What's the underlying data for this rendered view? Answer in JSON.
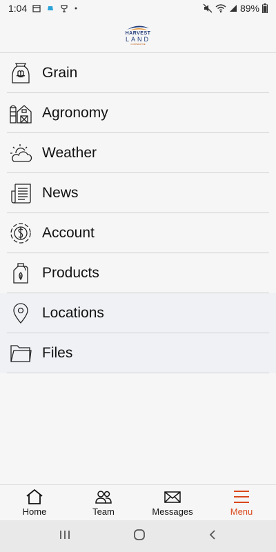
{
  "status_bar": {
    "time": "1:04",
    "battery": "89%"
  },
  "header": {
    "logo_line1": "HARVEST",
    "logo_line2": "LAND",
    "logo_tagline": "COOPERATIVE"
  },
  "menu": {
    "items": [
      {
        "label": "Grain",
        "icon": "grain-sack-icon"
      },
      {
        "label": "Agronomy",
        "icon": "barn-icon"
      },
      {
        "label": "Weather",
        "icon": "sun-cloud-icon"
      },
      {
        "label": "News",
        "icon": "newspaper-icon"
      },
      {
        "label": "Account",
        "icon": "dollar-circle-icon"
      },
      {
        "label": "Products",
        "icon": "jug-icon"
      },
      {
        "label": "Locations",
        "icon": "map-pin-icon"
      },
      {
        "label": "Files",
        "icon": "folder-icon"
      }
    ]
  },
  "bottom_nav": {
    "home": "Home",
    "team": "Team",
    "messages": "Messages",
    "menu": "Menu",
    "active": "Menu"
  },
  "colors": {
    "accent": "#d9471a",
    "brand_blue": "#1f3b78",
    "brand_orange": "#e8902a"
  }
}
